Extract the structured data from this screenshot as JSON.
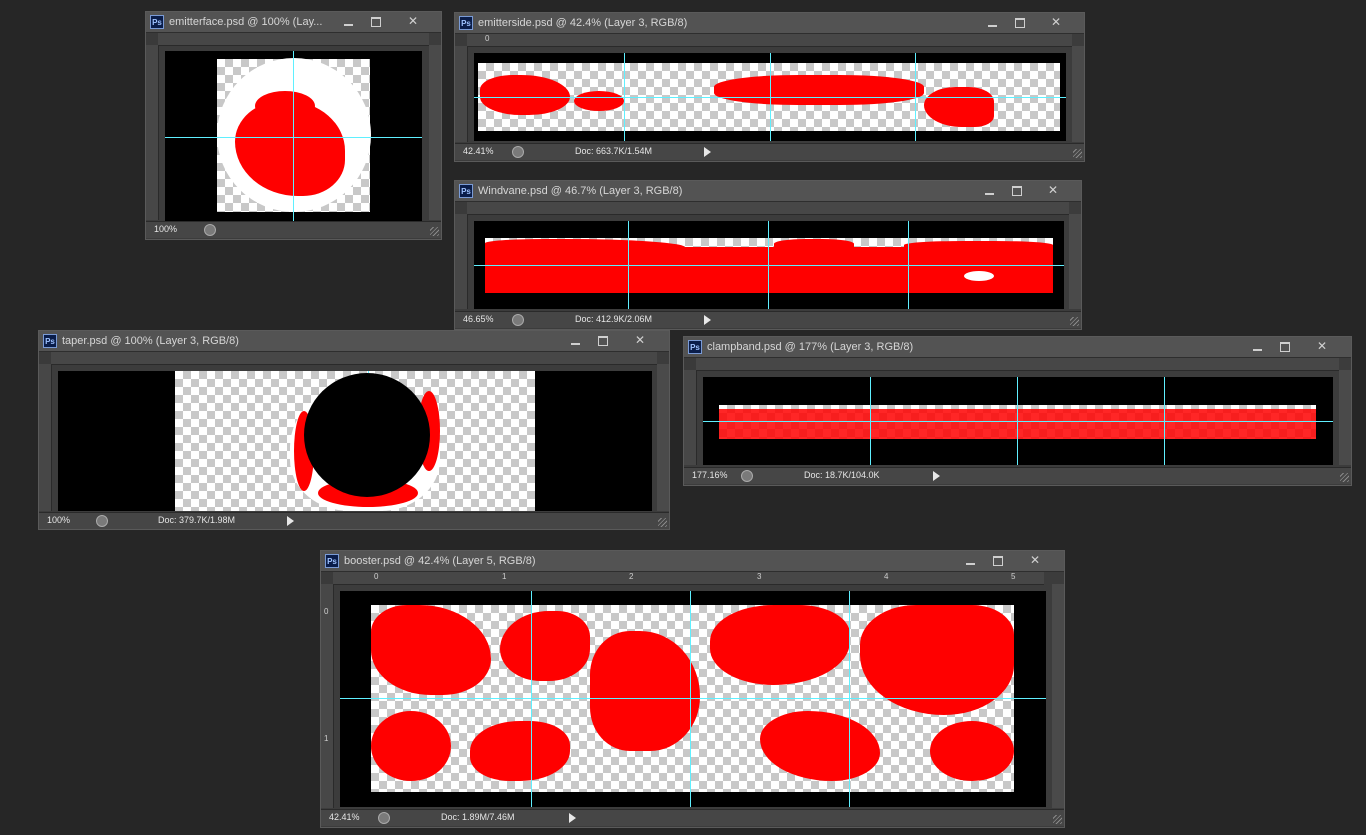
{
  "windows": {
    "emitterface": {
      "title": "emitterface.psd @ 100% (Lay...",
      "zoom": "100%",
      "doc": ""
    },
    "emitterside": {
      "title": "emitterside.psd @ 42.4% (Layer 3, RGB/8)",
      "zoom": "42.41%",
      "doc": "Doc: 663.7K/1.54M"
    },
    "windvane": {
      "title": "Windvane.psd @ 46.7% (Layer 3, RGB/8)",
      "zoom": "46.65%",
      "doc": "Doc: 412.9K/2.06M"
    },
    "taper": {
      "title": "taper.psd @ 100% (Layer 3, RGB/8)",
      "zoom": "100%",
      "doc": "Doc: 379.7K/1.98M"
    },
    "clampband": {
      "title": "clampband.psd @ 177% (Layer 3, RGB/8)",
      "zoom": "177.16%",
      "doc": "Doc: 18.7K/104.0K"
    },
    "booster": {
      "title": "booster.psd @ 42.4% (Layer 5, RGB/8)",
      "zoom": "42.41%",
      "doc": "Doc: 1.89M/7.46M"
    }
  },
  "ruler": {
    "t0": "0",
    "t1": "1",
    "t2": "2",
    "t3": "3",
    "t4": "4",
    "t5": "5"
  },
  "app_icon": "Ps",
  "icons": {
    "app": "photoshop-icon",
    "minimize": "minimize-icon",
    "maximize": "maximize-icon",
    "close": "close-icon",
    "close_glyph": "✕"
  },
  "colors": {
    "texture": "#ff0000",
    "guide": "#5ff0ff",
    "canvas_bg": "#000000"
  }
}
